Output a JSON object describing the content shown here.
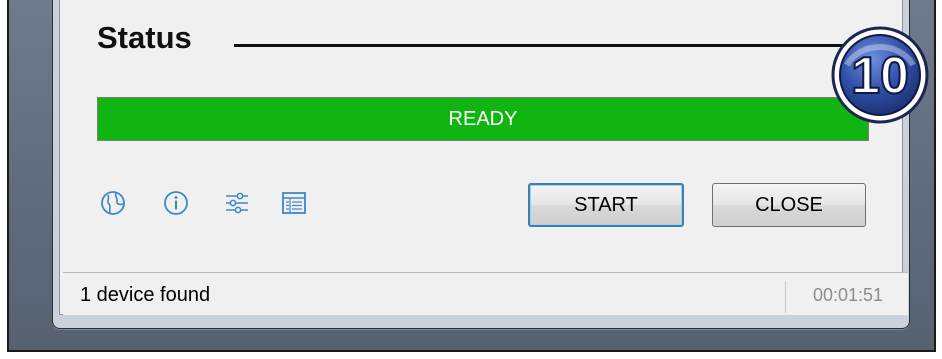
{
  "section": {
    "title": "Status"
  },
  "progress": {
    "label": "READY",
    "fraction": 1.0,
    "color": "#10b512"
  },
  "toolbar": {
    "icons": [
      "globe-icon",
      "info-icon",
      "settings-sliders-icon",
      "log-table-icon"
    ],
    "icon_color": "#3c88c7"
  },
  "buttons": {
    "start": "START",
    "close": "CLOSE"
  },
  "statusbar": {
    "message": "1 device found",
    "elapsed": "00:01:51"
  },
  "badge": {
    "number": "10",
    "color": "#2f4fa8"
  }
}
